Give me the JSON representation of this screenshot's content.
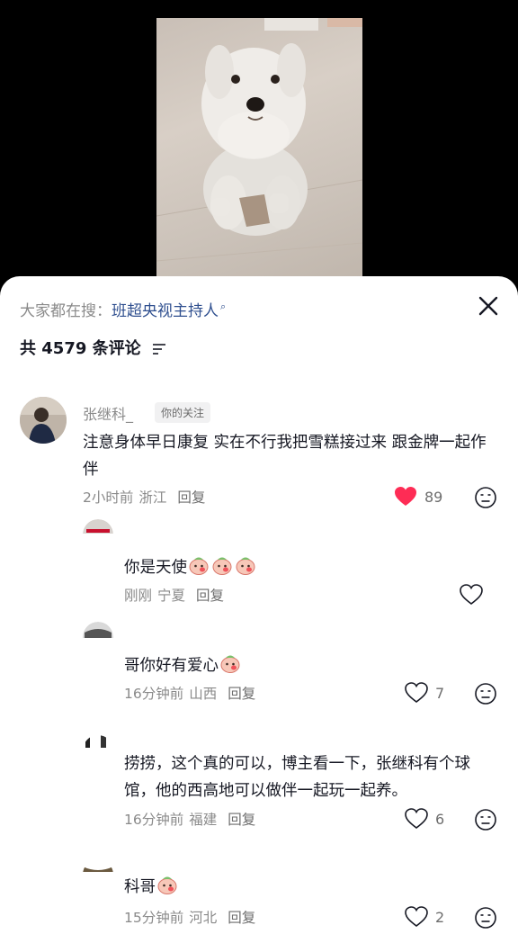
{
  "search": {
    "prefix": "大家都在搜：",
    "keyword": "班超央视主持人",
    "icon": "search-icon"
  },
  "comments_header": {
    "count_label": "共 4579 条评论",
    "sort_icon": "sort-icon"
  },
  "comments": [
    {
      "name": "张继科_",
      "badge": "你的关注",
      "text": "注意身体早日康复 实在不行我把雪糕接过来 跟金牌一起作伴",
      "time": "2小时前",
      "location": "浙江",
      "reply": "回复",
      "likes": "89",
      "liked": true
    }
  ],
  "replies": [
    {
      "text": "你是天使",
      "emoji_count": 3,
      "time": "刚刚",
      "location": "宁夏",
      "reply": "回复",
      "likes": ""
    },
    {
      "text": "哥你好有爱心",
      "emoji_count": 1,
      "time": "16分钟前",
      "location": "山西",
      "reply": "回复",
      "likes": "7"
    },
    {
      "text": "捞捞，这个真的可以，博主看一下，张继科有个球馆，他的西高地可以做伴一起玩一起养。",
      "emoji_count": 0,
      "time": "16分钟前",
      "location": "福建",
      "reply": "回复",
      "likes": "6"
    },
    {
      "text": "科哥",
      "emoji_count": 1,
      "time": "15分钟前",
      "location": "河北",
      "reply": "回复",
      "likes": "2"
    }
  ],
  "colors": {
    "liked_heart": "#fe2c55",
    "keyword": "#2f4f8f",
    "primary_text": "#161823",
    "secondary_text": "#8a8a8a"
  }
}
